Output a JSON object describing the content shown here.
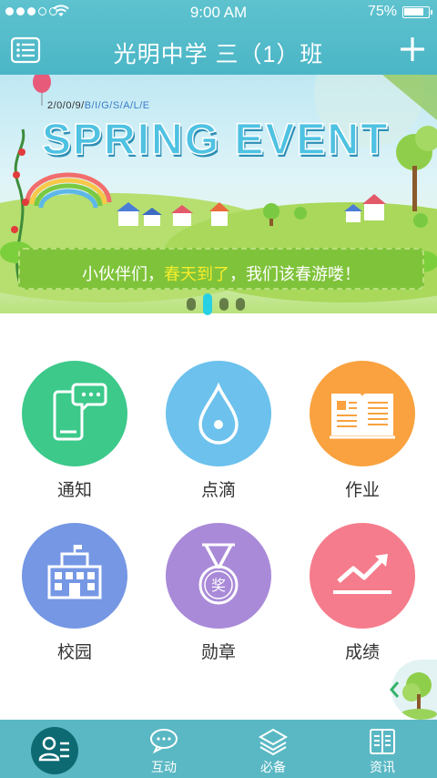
{
  "status": {
    "time": "9:00 AM",
    "battery": "75%",
    "battery_level": 0.75
  },
  "nav": {
    "title": "光明中学  三（1）班"
  },
  "banner": {
    "subtitle_prefix": "2/0/0/9/",
    "subtitle_accent": "B/I/G/S/A/L/E",
    "headline": "SPRING EVENT",
    "ribbon_pre": "小伙伴们，",
    "ribbon_highlight": "春天到了",
    "ribbon_post": "，我们该春游喽！",
    "page_index": 1,
    "page_count": 4
  },
  "grid": {
    "items": [
      {
        "label": "通知",
        "color": "#3cc98a",
        "icon": "phone-chat-icon"
      },
      {
        "label": "点滴",
        "color": "#6cc1ed",
        "icon": "droplet-icon"
      },
      {
        "label": "作业",
        "color": "#f9a23f",
        "icon": "book-icon"
      },
      {
        "label": "校园",
        "color": "#7597e4",
        "icon": "school-building-icon"
      },
      {
        "label": "勋章",
        "color": "#a98ad8",
        "icon": "medal-icon",
        "medal_text": "奖"
      },
      {
        "label": "成绩",
        "color": "#f57c8c",
        "icon": "trend-up-icon"
      }
    ]
  },
  "tabbar": {
    "items": [
      {
        "label": "",
        "icon": "contacts-icon",
        "active": true
      },
      {
        "label": "互动",
        "icon": "chat-bubbles-icon"
      },
      {
        "label": "必备",
        "icon": "layers-icon"
      },
      {
        "label": "资讯",
        "icon": "news-book-icon"
      }
    ]
  },
  "colors": {
    "header": "#4bb6c6",
    "tabbar": "#5ab8c4",
    "active_tab": "#0d6a72"
  }
}
